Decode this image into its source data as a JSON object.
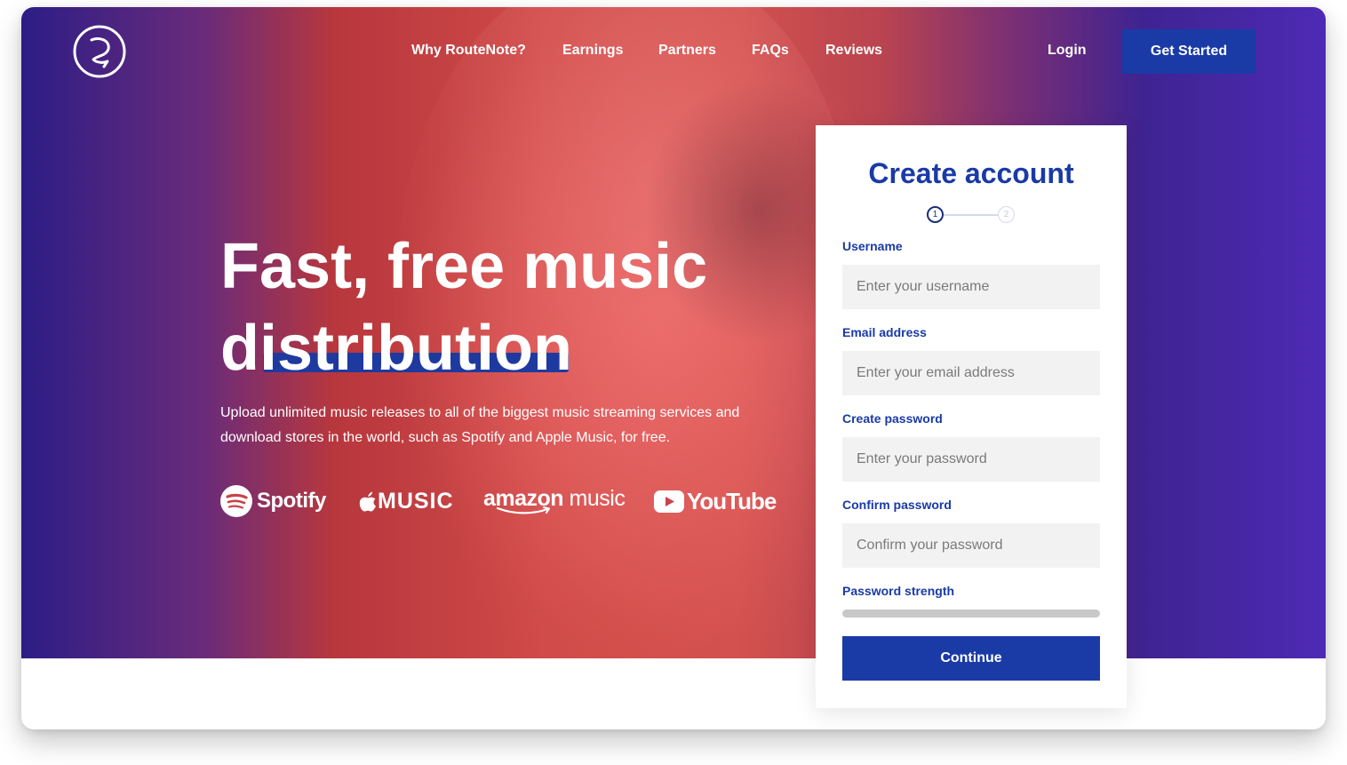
{
  "nav": {
    "logo_icon": "routenote-r-logo-icon",
    "links": [
      "Why RouteNote?",
      "Earnings",
      "Partners",
      "FAQs",
      "Reviews"
    ],
    "login": "Login",
    "cta": "Get Started"
  },
  "hero": {
    "headline_line1": "Fast, free music",
    "headline_line2": "distribution",
    "subtext": "Upload unlimited music releases to all of the biggest music streaming services and download stores in the world, such as Spotify and Apple Music, for free.",
    "partners": {
      "spotify": "Spotify",
      "apple": "MUSIC",
      "amazon_brand": "amazon",
      "amazon_suffix": "music",
      "youtube": "YouTube"
    }
  },
  "form": {
    "title": "Create account",
    "steps": [
      "1",
      "2"
    ],
    "current_step": 1,
    "username_label": "Username",
    "username_placeholder": "Enter your username",
    "email_label": "Email address",
    "email_placeholder": "Enter your email address",
    "password_label": "Create password",
    "password_placeholder": "Enter your password",
    "confirm_label": "Confirm password",
    "confirm_placeholder": "Confirm your password",
    "strength_label": "Password strength",
    "strength_value": 0,
    "continue": "Continue"
  },
  "colors": {
    "accent_blue": "#1a3aa6",
    "hero_red": "#d2504d",
    "hero_purple": "#4e2ab5"
  }
}
